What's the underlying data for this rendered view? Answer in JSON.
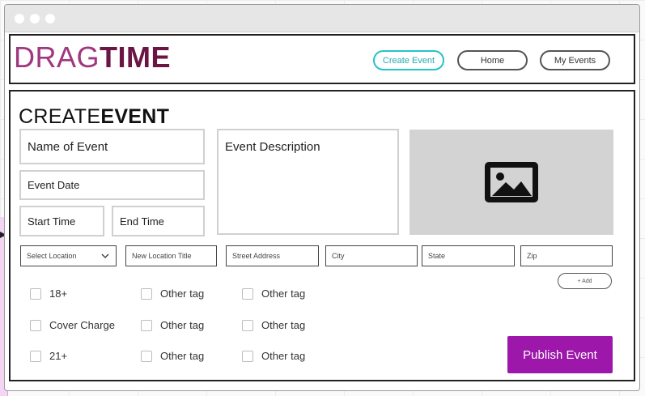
{
  "brand": {
    "part1": "DRAG",
    "part2": "TIME"
  },
  "nav": {
    "create_event": "Create Event",
    "home": "Home",
    "my_events": "My Events"
  },
  "page": {
    "title_light": "CREATE",
    "title_bold": "EVENT"
  },
  "form": {
    "name_placeholder": "Name of Event",
    "date_placeholder": "Event Date",
    "start_time_placeholder": "Start Time",
    "end_time_placeholder": "End Time",
    "description_placeholder": "Event Description",
    "image_icon": "image-icon",
    "location_select": "Select Location",
    "new_location_title": "New Location Title",
    "street_address": "Street Address",
    "city": "City",
    "state": "State",
    "zip": "Zip",
    "add_button": "+ Add"
  },
  "tags": {
    "col1": [
      "18+",
      "Cover Charge",
      "21+"
    ],
    "col2": [
      "Other tag",
      "Other tag",
      "Other tag"
    ],
    "col3": [
      "Other tag",
      "Other tag",
      "Other tag"
    ]
  },
  "publish_label": "Publish Event",
  "colors": {
    "brand_light": "#a0377f",
    "brand_dark": "#6b1545",
    "active_nav": "#27c2c8",
    "publish": "#9c17aa"
  }
}
